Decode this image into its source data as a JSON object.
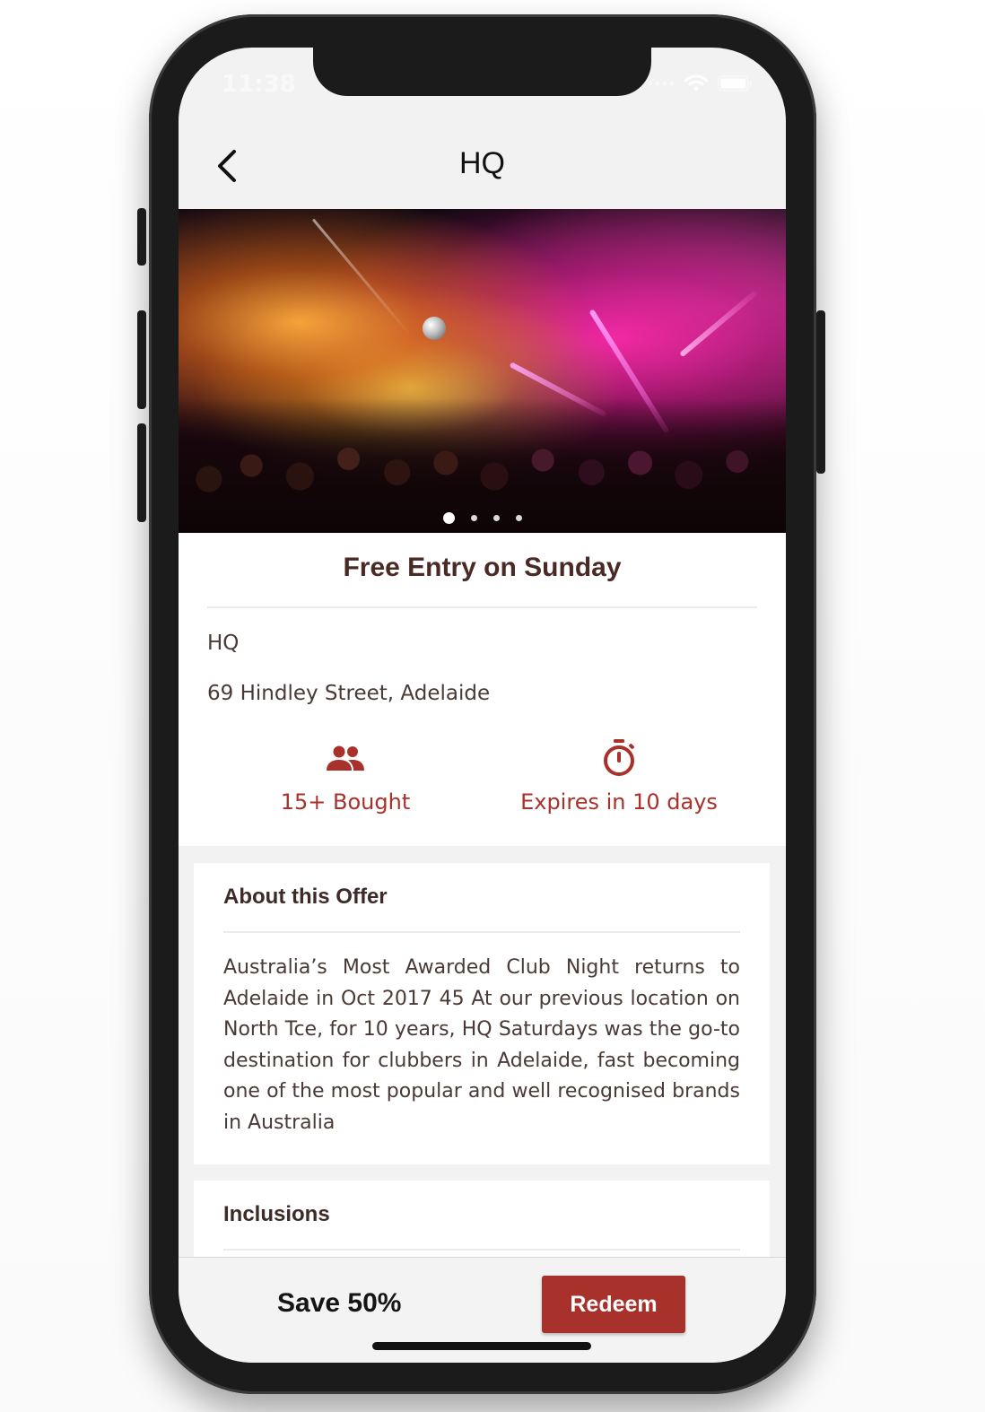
{
  "status_bar": {
    "time": "11:38",
    "icons": [
      "signal-icon",
      "wifi-icon",
      "battery-icon"
    ]
  },
  "nav": {
    "title": "HQ",
    "back_icon": "chevron-left-icon"
  },
  "hero": {
    "image_alt": "Nightclub crowd under pink and yellow stage lights",
    "slide_count": 4,
    "active_slide": 0
  },
  "offer": {
    "title": "Free Entry on Sunday",
    "venue": "HQ",
    "address": "69 Hindley Street, Adelaide",
    "stats": [
      {
        "icon": "people-icon",
        "label": "15+ Bought"
      },
      {
        "icon": "timer-icon",
        "label": "Expires in 10 days"
      }
    ]
  },
  "about": {
    "title": "About this Offer",
    "body": "Australia’s Most Awarded Club Night returns to Adelaide in Oct 2017 45 At our previous location on North Tce, for 10 years, HQ Saturdays was the go-to destination for clubbers in Adelaide, fast becoming one of the most popular and well recognised brands in Australia"
  },
  "inclusions": {
    "title": "Inclusions"
  },
  "footer": {
    "save_label": "Save 50%",
    "redeem_label": "Redeem"
  },
  "colors": {
    "accent": "#a8322b",
    "title_text": "#4a2a25",
    "body_text": "#4a3a36",
    "background": "#f2f2f2"
  }
}
